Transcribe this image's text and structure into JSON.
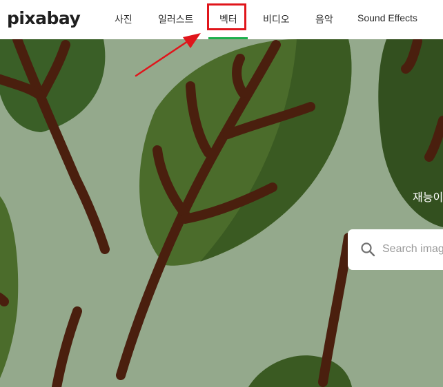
{
  "brand": {
    "logo_text": "pixabay"
  },
  "nav": {
    "items": [
      {
        "label": "사진"
      },
      {
        "label": "일러스트"
      },
      {
        "label": "벡터",
        "active": true
      },
      {
        "label": "비디오"
      },
      {
        "label": "음악"
      },
      {
        "label": "Sound Effects"
      }
    ],
    "active_color": "#1cb04c"
  },
  "hero": {
    "title_fragment": "재능이",
    "background_color": "#94a98c",
    "leaf_color": "#3a5f27",
    "stem_color": "#4a1f0e"
  },
  "search": {
    "placeholder": "Search images",
    "icon": "search-icon"
  },
  "annotation": {
    "highlight_color": "#e0151b",
    "arrow_icon": "arrow-icon"
  }
}
